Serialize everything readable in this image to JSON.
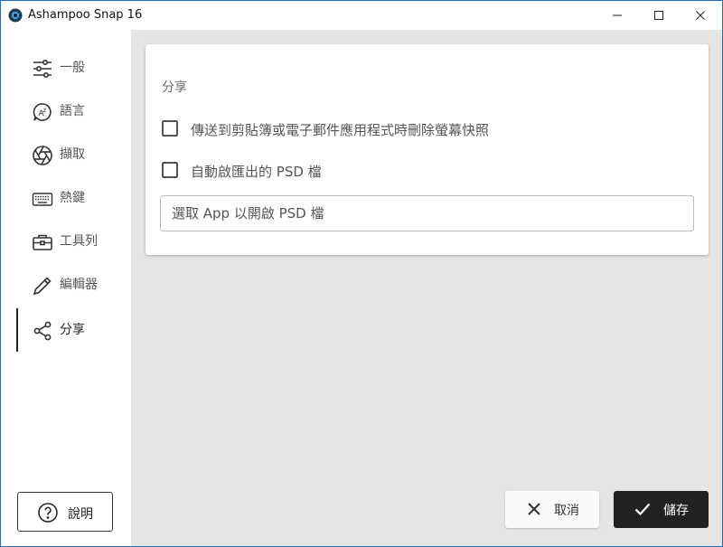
{
  "window": {
    "title": "Ashampoo Snap 16",
    "accent_color": "#1f6fb8"
  },
  "sidebar": {
    "items": [
      {
        "label": "一般",
        "icon": "sliders-icon",
        "active": false
      },
      {
        "label": "語言",
        "icon": "language-icon",
        "active": false
      },
      {
        "label": "擷取",
        "icon": "aperture-icon",
        "active": false
      },
      {
        "label": "熱鍵",
        "icon": "keyboard-icon",
        "active": false
      },
      {
        "label": "工具列",
        "icon": "toolbox-icon",
        "active": false
      },
      {
        "label": "編輯器",
        "icon": "pencil-icon",
        "active": false
      },
      {
        "label": "分享",
        "icon": "share-icon",
        "active": true
      }
    ],
    "help_label": "說明"
  },
  "main": {
    "section_title": "分享",
    "options": [
      {
        "label": "傳送到剪貼簿或電子郵件應用程式時刪除螢幕快照",
        "checked": false
      },
      {
        "label": "自動啟匯出的 PSD 檔",
        "checked": false
      }
    ],
    "app_input_placeholder": "選取 App 以開啟 PSD 檔"
  },
  "footer": {
    "cancel_label": "取消",
    "save_label": "儲存"
  }
}
